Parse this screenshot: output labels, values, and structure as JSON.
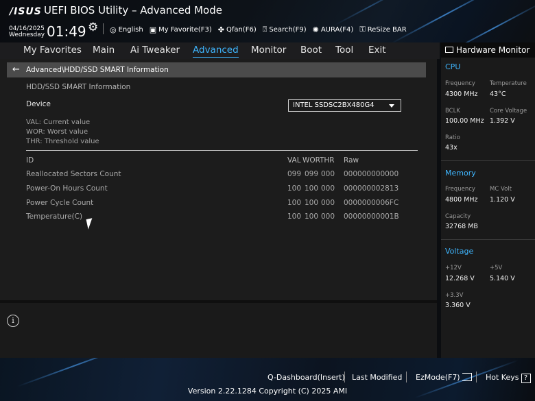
{
  "header": {
    "logo": "/ISUS",
    "title": "UEFI BIOS Utility – Advanced Mode",
    "date": "04/16/2025",
    "weekday": "Wednesday",
    "time": "01:49",
    "items": [
      {
        "icon": "globe-icon",
        "label": "English"
      },
      {
        "icon": "favorite-icon",
        "label": "My Favorite(F3)"
      },
      {
        "icon": "fan-icon",
        "label": "Qfan(F6)"
      },
      {
        "icon": "search-icon",
        "label": "Search(F9)"
      },
      {
        "icon": "aura-icon",
        "label": "AURA(F4)"
      },
      {
        "icon": "resize-bar-icon",
        "label": "ReSize BAR"
      }
    ]
  },
  "menu": {
    "tabs": [
      "My Favorites",
      "Main",
      "Ai Tweaker",
      "Advanced",
      "Monitor",
      "Boot",
      "Tool",
      "Exit"
    ],
    "active": "Advanced"
  },
  "main": {
    "breadcrumb": "Advanced\\HDD/SSD SMART Information",
    "subtitle": "HDD/SSD SMART Information",
    "device_label": "Device",
    "device_value": "INTEL SSDSC2BX480G4",
    "legend": [
      "VAL:  Current value",
      "WOR: Worst value",
      "THR:  Threshold value"
    ],
    "columns": {
      "id": "ID",
      "val": "VAL",
      "wor": "WOR",
      "thr": "THR",
      "raw": "Raw"
    },
    "rows": [
      {
        "id": "Reallocated Sectors Count",
        "val": "099",
        "wor": "099",
        "thr": "000",
        "raw": "000000000000"
      },
      {
        "id": "Power-On Hours Count",
        "val": "100",
        "wor": "100",
        "thr": "000",
        "raw": "000000002813"
      },
      {
        "id": "Power Cycle Count",
        "val": "100",
        "wor": "100",
        "thr": "000",
        "raw": "0000000006FC"
      },
      {
        "id": "Temperature(C)",
        "val": "100",
        "wor": "100",
        "thr": "000",
        "raw": "00000000001B"
      }
    ],
    "info_icon": "i"
  },
  "hw": {
    "title": "Hardware Monitor",
    "cpu": {
      "heading": "CPU",
      "freq_label": "Frequency",
      "freq": "4300 MHz",
      "temp_label": "Temperature",
      "temp": "43°C",
      "bclk_label": "BCLK",
      "bclk": "100.00 MHz",
      "vcore_label": "Core Voltage",
      "vcore": "1.392 V",
      "ratio_label": "Ratio",
      "ratio": "43x"
    },
    "memory": {
      "heading": "Memory",
      "freq_label": "Frequency",
      "freq": "4800 MHz",
      "volt_label": "MC Volt",
      "volt": "1.120 V",
      "cap_label": "Capacity",
      "cap": "32768 MB"
    },
    "voltage": {
      "heading": "Voltage",
      "v12_label": "+12V",
      "v12": "12.268 V",
      "v5_label": "+5V",
      "v5": "5.140 V",
      "v33_label": "+3.3V",
      "v33": "3.360 V"
    }
  },
  "footer": {
    "qdash": "Q-Dashboard(Insert)",
    "last_modified": "Last Modified",
    "ezmode": "EzMode(F7)",
    "hotkeys": "Hot Keys",
    "hotkeys_icon": "?",
    "version": "Version 2.22.1284 Copyright (C) 2025 AMI"
  },
  "colors": {
    "accent": "#3fb6ff",
    "panel": "#1c1c1c",
    "breadcrumb": "#4b4b4b"
  }
}
